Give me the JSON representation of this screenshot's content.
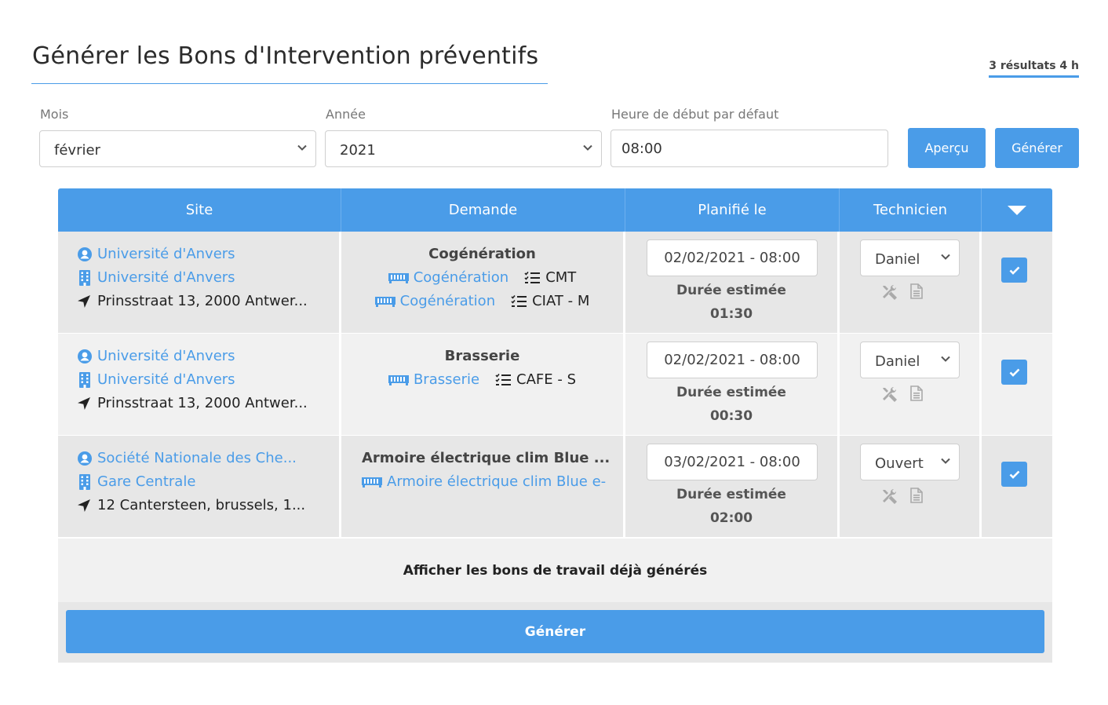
{
  "page": {
    "title": "Générer les Bons d'Intervention préventifs",
    "results": "3 résultats 4 h"
  },
  "filters": {
    "month_label": "Mois",
    "month_value": "février",
    "year_label": "Année",
    "year_value": "2021",
    "start_label": "Heure de début par défaut",
    "start_value": "08:00",
    "preview_button": "Aperçu",
    "generate_button": "Générer"
  },
  "table": {
    "columns": [
      "Site",
      "Demande",
      "Planifié le",
      "Technicien"
    ],
    "rows": [
      {
        "client": "Université d'Anvers",
        "building": "Université d'Anvers",
        "address": "Prinsstraat 13, 2000 Antwer...",
        "title": "Cogénération",
        "assets": [
          {
            "name": "Cogénération",
            "ref": "CMT"
          },
          {
            "name": "Cogénération",
            "ref": "CIAT - M"
          }
        ],
        "date": "02/02/2021 - 08:00",
        "duration_label": "Durée estimée",
        "duration": "01:30",
        "technician": "Daniel"
      },
      {
        "client": "Université d'Anvers",
        "building": "Université d'Anvers",
        "address": "Prinsstraat 13, 2000 Antwer...",
        "title": "Brasserie",
        "assets": [
          {
            "name": "Brasserie",
            "ref": "CAFE - S"
          }
        ],
        "date": "02/02/2021 - 08:00",
        "duration_label": "Durée estimée",
        "duration": "00:30",
        "technician": "Daniel"
      },
      {
        "client": "Société Nationale des Che...",
        "building": "Gare Centrale",
        "address": "12 Cantersteen, brussels, 1...",
        "title": "Armoire électrique clim Blue ...",
        "assets": [
          {
            "name": "Armoire électrique clim Blue e-"
          }
        ],
        "date": "03/02/2021 - 08:00",
        "duration_label": "Durée estimée",
        "duration": "02:00",
        "technician": "Ouvert"
      }
    ],
    "show_generated": "Afficher les bons de travail déjà générés",
    "generate_all": "Générer"
  },
  "colors": {
    "accent": "#4a9ce8",
    "row_dark": "#e7e7e7",
    "row_light": "#f1f1f1"
  },
  "icons": [
    "user-circle-icon",
    "building-icon",
    "location-arrow-icon",
    "equipment-icon",
    "checklist-icon",
    "wrench-icon",
    "document-icon",
    "checkbox-icon",
    "chevron-down-icon",
    "caret-down-icon"
  ]
}
